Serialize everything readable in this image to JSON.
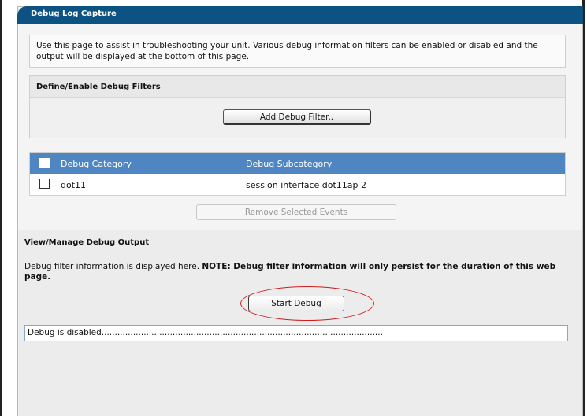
{
  "panel": {
    "title": "Debug Log Capture"
  },
  "intro": {
    "text": "Use this page to assist in troubleshooting your unit. Various debug information filters can be enabled or disabled and the output will be displayed at the bottom of this page."
  },
  "filters": {
    "heading": "Define/Enable Debug Filters",
    "add_button": "Add Debug Filter.."
  },
  "table": {
    "headers": {
      "category": "Debug Category",
      "subcategory": "Debug Subcategory"
    },
    "rows": [
      {
        "category": "dot11",
        "subcategory": "session interface dot11ap 2"
      }
    ]
  },
  "remove_button": "Remove Selected Events",
  "output": {
    "heading": "View/Manage Debug Output",
    "desc_prefix": "Debug filter information is displayed here. ",
    "desc_bold": "NOTE: Debug filter information will only persist for the duration of this web page.",
    "start_button": "Start Debug",
    "status_text": "Debug is disabled..........................................................................................................."
  },
  "colors": {
    "titlebar": "#0c5283",
    "table_header": "#4f86c1",
    "highlight": "#d01d1d"
  }
}
